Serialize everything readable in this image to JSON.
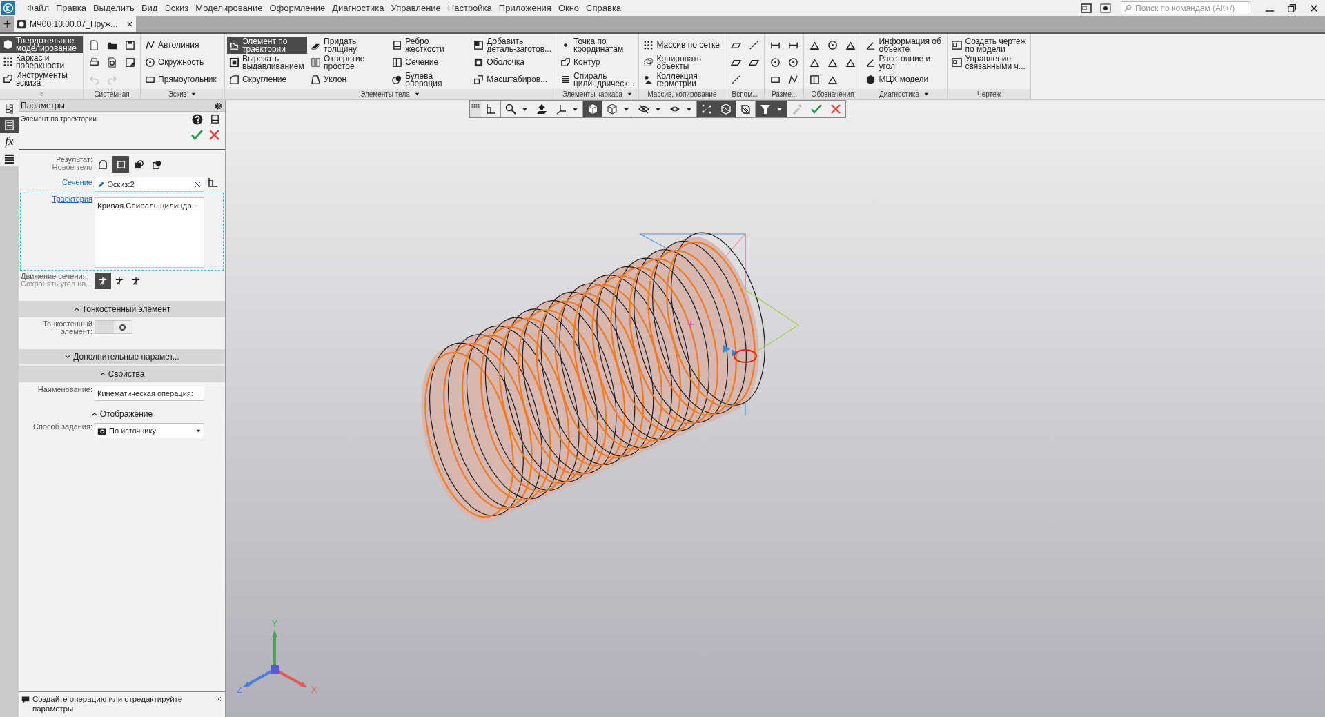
{
  "menu": [
    "Файл",
    "Правка",
    "Выделить",
    "Вид",
    "Эскиз",
    "Моделирование",
    "Оформление",
    "Диагностика",
    "Управление",
    "Настройка",
    "Приложения",
    "Окно",
    "Справка"
  ],
  "search": {
    "placeholder": "Поиск по командам (Alt+/)"
  },
  "document_tabs": [
    {
      "label": "МЧ00.10.00.07_Пруж...",
      "selected": true
    }
  ],
  "ribbon": {
    "modes": [
      {
        "label": "Твердотельное\nмоделирование",
        "selected": true
      },
      {
        "label": "Каркас и\nповерхности",
        "selected": false
      },
      {
        "label": "Инструменты\nэскиза",
        "selected": false
      }
    ],
    "groups": [
      {
        "kind": "icons",
        "label": "Системная",
        "dropdown": false,
        "columns": [
          [
            {
              "disabled": false
            },
            {
              "disabled": false
            },
            {
              "disabled": true
            }
          ],
          [
            {
              "disabled": false
            },
            {
              "disabled": false
            },
            {
              "disabled": true
            }
          ],
          [
            {
              "disabled": false
            },
            {
              "disabled": false
            }
          ]
        ]
      },
      {
        "kind": "commands",
        "label": "Эскиз",
        "dropdown": true,
        "columns": [
          [
            {
              "label": "Автолиния",
              "selected": false
            },
            {
              "label": "Окружность",
              "selected": false
            },
            {
              "label": "Прямоугольник",
              "selected": false
            }
          ]
        ]
      },
      {
        "kind": "commands",
        "label": "Элементы тела",
        "dropdown": true,
        "columns": [
          [
            {
              "label": "Элемент по\nтраектории",
              "selected": true
            },
            {
              "label": "Вырезать\nвыдавливанием",
              "selected": false
            },
            {
              "label": "Скругление",
              "selected": false
            }
          ],
          [
            {
              "label": "Придать\nтолщину",
              "selected": false
            },
            {
              "label": "Отверстие\nпростое",
              "selected": false
            },
            {
              "label": "Уклон",
              "selected": false
            }
          ],
          [
            {
              "label": "Ребро\nжесткости",
              "selected": false
            },
            {
              "label": "Сечение",
              "selected": false
            },
            {
              "label": "Булева\nоперация",
              "selected": false
            }
          ],
          [
            {
              "label": "Добавить\nдеталь-заготов...",
              "selected": false
            },
            {
              "label": "Оболочка",
              "selected": false
            },
            {
              "label": "Масштабиров...",
              "selected": false
            }
          ]
        ]
      },
      {
        "kind": "commands",
        "label": "Элементы каркаса",
        "dropdown": true,
        "columns": [
          [
            {
              "label": "Точка по\nкоординатам",
              "selected": false
            },
            {
              "label": "Контур",
              "selected": false
            },
            {
              "label": "Спираль\nцилиндрическ...",
              "selected": false
            }
          ]
        ]
      },
      {
        "kind": "commands",
        "label": "Массив, копирование",
        "dropdown": false,
        "columns": [
          [
            {
              "label": "Массив по сетке",
              "selected": false
            },
            {
              "label": "Копировать\nобъекты",
              "selected": false
            },
            {
              "label": "Коллекция\nгеометрии",
              "selected": false
            }
          ]
        ]
      },
      {
        "kind": "icons",
        "label": "Вспом...",
        "dropdown": false,
        "columns": [
          [
            {
              "disabled": false
            },
            {
              "disabled": false
            },
            {
              "disabled": false
            }
          ],
          [
            {
              "disabled": false
            },
            {
              "disabled": false
            }
          ]
        ]
      },
      {
        "kind": "icons",
        "label": "Разме...",
        "dropdown": false,
        "columns": [
          [
            {
              "disabled": false
            },
            {
              "disabled": false
            },
            {
              "disabled": false
            }
          ],
          [
            {
              "disabled": false
            },
            {
              "disabled": false
            },
            {
              "disabled": false
            }
          ]
        ]
      },
      {
        "kind": "icons",
        "label": "Обозначения",
        "dropdown": false,
        "columns": [
          [
            {
              "disabled": false
            },
            {
              "disabled": false
            },
            {
              "disabled": false
            }
          ],
          [
            {
              "disabled": false
            },
            {
              "disabled": false
            },
            {
              "disabled": false
            }
          ],
          [
            {
              "disabled": false
            },
            {
              "disabled": false
            }
          ]
        ]
      },
      {
        "kind": "commands",
        "label": "Диагностика",
        "dropdown": true,
        "columns": [
          [
            {
              "label": "Информация об\nобъекте",
              "selected": false
            },
            {
              "label": "Расстояние и\nугол",
              "selected": false
            },
            {
              "label": "МЦХ модели",
              "selected": false
            }
          ]
        ]
      },
      {
        "kind": "commands",
        "label": "Чертеж",
        "dropdown": false,
        "columns": [
          [
            {
              "label": "Создать чертеж\nпо модели",
              "selected": false
            },
            {
              "label": "Управление\nсвязанными ч...",
              "selected": false
            }
          ]
        ]
      }
    ]
  },
  "side_tabs": [
    {
      "selected": false
    },
    {
      "selected": true
    },
    {
      "label": "fx",
      "selected": false
    },
    {
      "selected": false
    }
  ],
  "panel": {
    "title": "Параметры",
    "operation": "Элемент по траектории",
    "result": {
      "label": "Результат:",
      "value": "Новое тело",
      "options": [
        {
          "selected": false
        },
        {
          "selected": true
        },
        {
          "selected": false
        },
        {
          "selected": false
        }
      ]
    },
    "section_field": {
      "label": "Сечение",
      "value": "Эскиз:2"
    },
    "trajectory": {
      "label": "Траектория",
      "items": [
        "Кривая.Спираль цилиндр..."
      ],
      "active": true
    },
    "motion": {
      "label": "Движение сечения:",
      "value": "Сохранять угол на...",
      "options": [
        {
          "selected": true
        },
        {
          "selected": false
        },
        {
          "selected": false
        }
      ]
    },
    "sections": [
      {
        "kind": "thin",
        "title": "Тонкостенный элемент",
        "expanded": true,
        "toggle": {
          "label": "Тонкостенный\nэлемент:",
          "on": false
        }
      },
      {
        "kind": "more",
        "title": "Дополнительные парамет...",
        "expanded": false
      },
      {
        "kind": "props",
        "title": "Свойства",
        "expanded": true,
        "name": {
          "label": "Наименование:",
          "value": "Кинематическая операция:"
        },
        "subsection": {
          "title": "Отображение",
          "expanded": true
        },
        "method": {
          "label": "Способ задания:",
          "value": "По источнику"
        }
      }
    ],
    "hint": "Создайте операцию или отредактируйте параметры"
  },
  "view_toolbar": [
    {
      "selected": false,
      "dropdown": false,
      "disabled": false
    },
    {
      "selected": false,
      "dropdown": true,
      "disabled": false
    },
    {
      "selected": false,
      "dropdown": false,
      "disabled": false
    },
    {
      "selected": false,
      "dropdown": true,
      "disabled": false
    },
    {
      "selected": true,
      "dropdown": false,
      "disabled": false
    },
    {
      "selected": false,
      "dropdown": true,
      "disabled": false
    },
    {
      "selected": false,
      "dropdown": true,
      "disabled": false
    },
    {
      "selected": false,
      "dropdown": true,
      "disabled": false
    },
    {
      "selected": true,
      "dropdown": false,
      "disabled": false
    },
    {
      "selected": true,
      "dropdown": false,
      "disabled": false
    },
    {
      "selected": false,
      "dropdown": false,
      "disabled": false
    },
    {
      "selected": true,
      "dropdown": true,
      "disabled": false
    },
    {
      "selected": false,
      "dropdown": false,
      "disabled": true
    },
    {
      "selected": false,
      "dropdown": false,
      "disabled": false
    },
    {
      "selected": false,
      "dropdown": false,
      "disabled": false
    }
  ],
  "axes": [
    {
      "label": "X",
      "color": "#e05a5a"
    },
    {
      "label": "Y",
      "color": "#3fae4a"
    },
    {
      "label": "Z",
      "color": "#4a7fe0"
    }
  ]
}
